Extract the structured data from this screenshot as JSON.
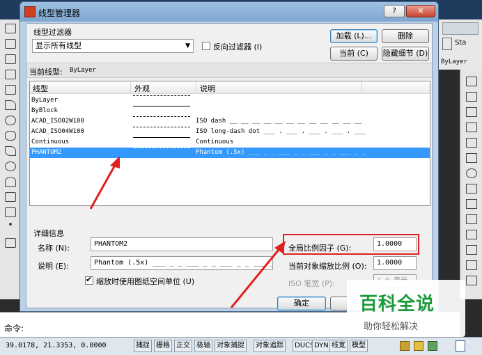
{
  "colors": {
    "selection": "#3399ff",
    "annotation_red": "#e02020",
    "watermark_green": "#1a9a3a"
  },
  "dialog": {
    "title": "线型管理器",
    "help_glyph": "?",
    "close_glyph": "✕",
    "filter": {
      "group_label": "线型过滤器",
      "selected": "显示所有线型",
      "invert_label": "反向过滤器 (I)",
      "invert_checked": false
    },
    "buttons": {
      "load": "加载 (L)...",
      "delete": "删除",
      "current": "当前 (C)",
      "hide_details": "隐藏细节 (D)",
      "ok": "确定"
    },
    "current_linetype": {
      "label": "当前线型:",
      "value": "ByLayer"
    },
    "list": {
      "columns": [
        "线型",
        "外观",
        "说明"
      ],
      "rows": [
        {
          "name": "ByLayer",
          "appearance": "——·——·——",
          "description": "",
          "selected": false
        },
        {
          "name": "ByBlock",
          "appearance": "——————————",
          "description": "",
          "selected": false
        },
        {
          "name": "ACAD_ISO02W100",
          "appearance": "—— —— —— ——",
          "description": "ISO dash __ __ __ __ __ __ __ __ __ __ __ __",
          "selected": false
        },
        {
          "name": "ACAD_ISO04W100",
          "appearance": "———  ·  ———  ·",
          "description": "ISO long-dash dot ___ . ___ . ___ . ___ . ___",
          "selected": false
        },
        {
          "name": "Continuous",
          "appearance": "——————————",
          "description": "Continuous",
          "selected": false
        },
        {
          "name": "PHANTOM2",
          "appearance": "——··——··——",
          "description": "Phantom (.5x) ___ _ _ ___ _ _ ___ _ _ ___ _ _",
          "selected": true
        }
      ]
    },
    "details": {
      "group_label": "详细信息",
      "name_label": "名称 (N):",
      "name_value": "PHANTOM2",
      "desc_label": "说明 (E):",
      "desc_value": "Phantom (.5x) ___ _ _ ___ _ _ ___ _ _ ___ _ _",
      "paper_units_label": "缩放时使用图纸空间单位 (U)",
      "paper_units_checked": true,
      "global_scale_label": "全局比例因子 (G):",
      "global_scale_value": "1.0000",
      "current_scale_label": "当前对象缩放比例 (O):",
      "current_scale_value": "1.0000",
      "iso_pen_label": "ISO 笔宽 (P):",
      "iso_pen_value": "1.0 毫米"
    }
  },
  "cad": {
    "top_right_text": "Sta",
    "layer_text": "ByLayer",
    "command_prompt": "命令:",
    "coordinates": "39.0178, 21.3353, 0.0000",
    "status_buttons": [
      "捕捉",
      "栅格",
      "正交",
      "极轴",
      "对象捕捉",
      "对象追踪",
      "DUCS",
      "DYN",
      "线宽",
      "模型"
    ]
  },
  "watermark": {
    "title": "百科全说",
    "subtitle": "助你轻松解决"
  }
}
